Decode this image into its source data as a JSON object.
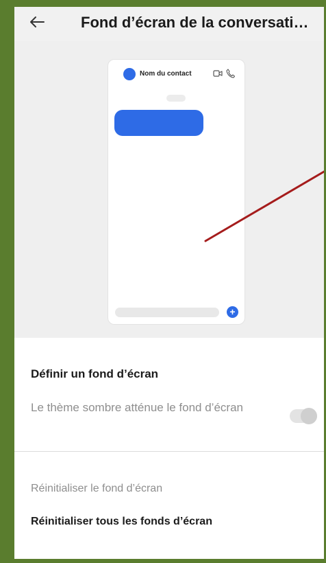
{
  "header": {
    "title": "Fond d’écran de la conversati…"
  },
  "preview": {
    "contact_name": "Nom du contact"
  },
  "settings": {
    "define_wallpaper": "Définir un fond d’écran",
    "dark_theme_dims": "Le thème sombre atténue le fond d’écran",
    "dark_theme_toggle": false,
    "reset_wallpaper": "Réinitialiser le fond d’écran",
    "reset_all_wallpapers": "Réinitialiser tous les fonds d’écran"
  },
  "annotation": {
    "arrow_color": "#a51c1c"
  },
  "colors": {
    "accent": "#2e6be6",
    "frame": "#5a7d2e"
  }
}
